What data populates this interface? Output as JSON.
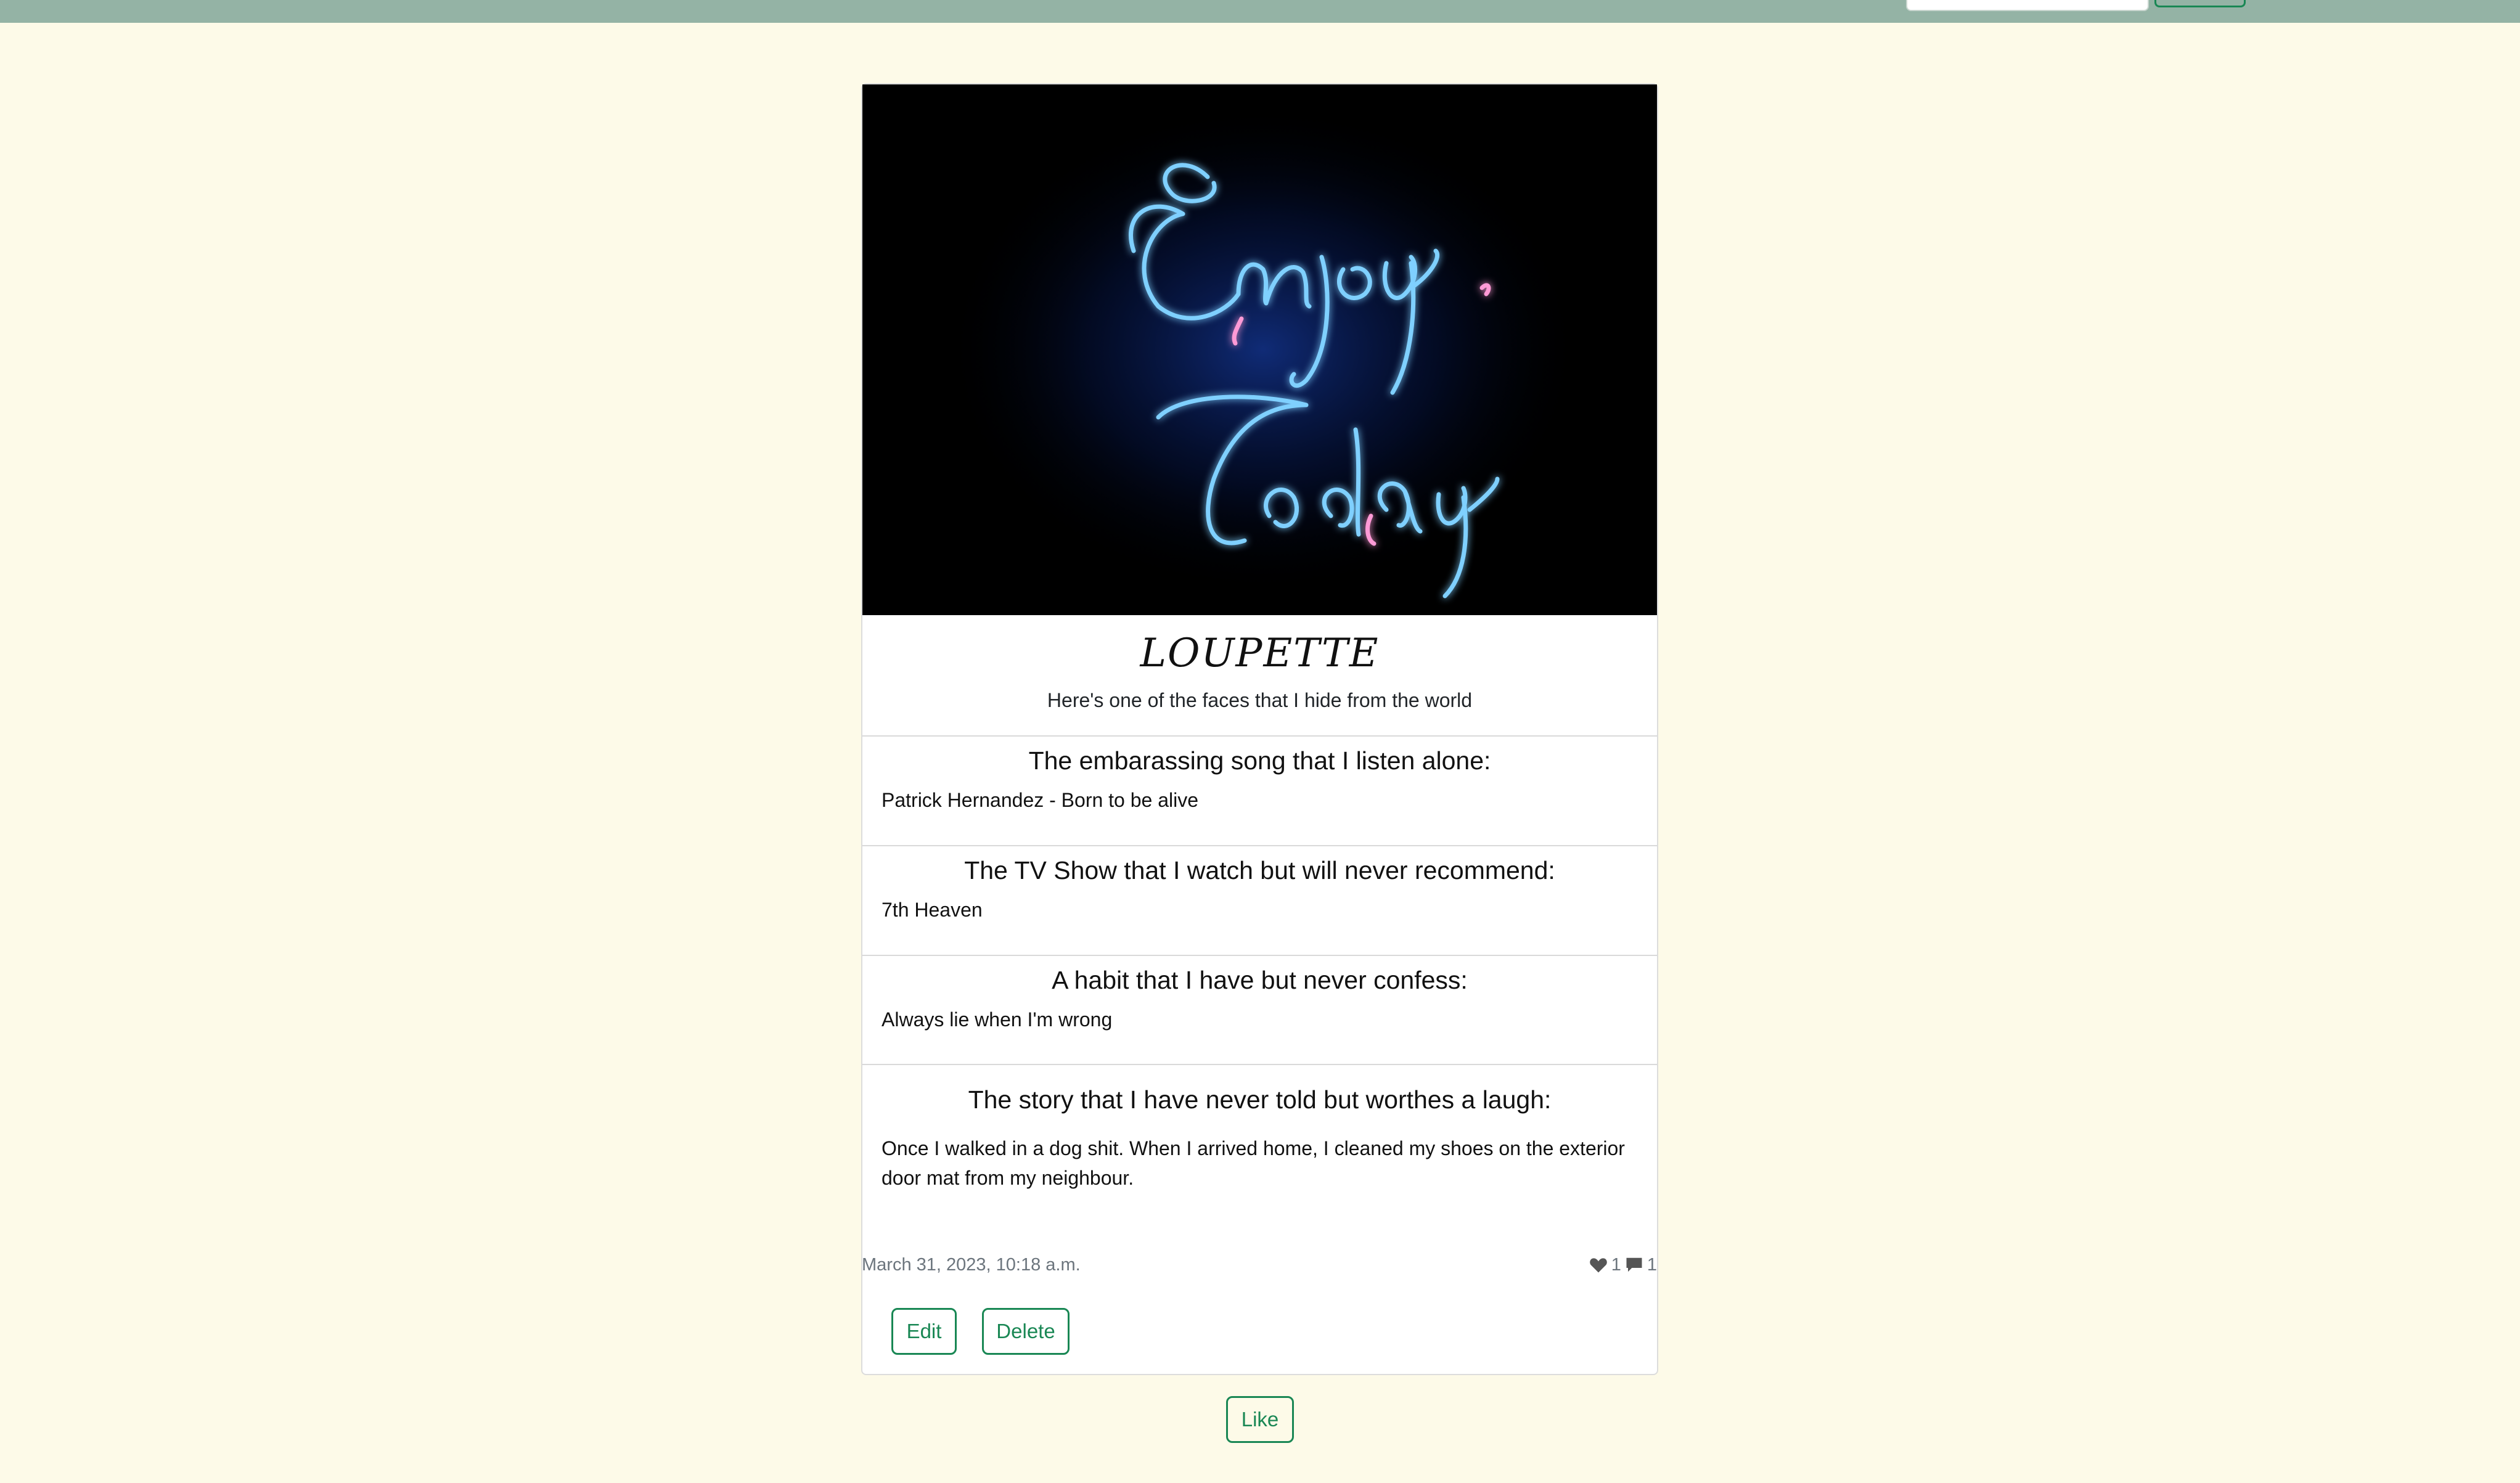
{
  "navbar": {
    "search_input_value": "",
    "search_button_label": ""
  },
  "post": {
    "image_alt": "Enjoy Today neon sign",
    "nickname": "LOUPETTE",
    "tagline": "Here's one of the faces that I hide from the world",
    "sections": [
      {
        "title": "The embarassing song that I listen alone:",
        "answer": "Patrick Hernandez - Born to be alive"
      },
      {
        "title": "The TV Show that I watch but will never recommend:",
        "answer": "7th Heaven"
      },
      {
        "title": "A habit that I have but never confess:",
        "answer": "Always lie when I'm wrong"
      },
      {
        "title": "The story that I have never told but worthes a laugh:",
        "answer": "Once I walked in a dog shit. When I arrived home, I cleaned my shoes on the exterior door mat from my neighbour."
      }
    ],
    "date": "March 31, 2023, 10:18 a.m.",
    "likes_count": "1",
    "comments_count": "1",
    "icons": {
      "likes": "heart-icon",
      "comments": "comment-icon"
    }
  },
  "actions": {
    "edit_label": "Edit",
    "delete_label": "Delete",
    "like_label": "Like"
  },
  "colors": {
    "navbar_bg": "#94b3a5",
    "page_bg": "#fdfae8",
    "accent_green": "#198754",
    "neon_blue": "#6ec6ff",
    "neon_pink": "#ff8fd0"
  }
}
